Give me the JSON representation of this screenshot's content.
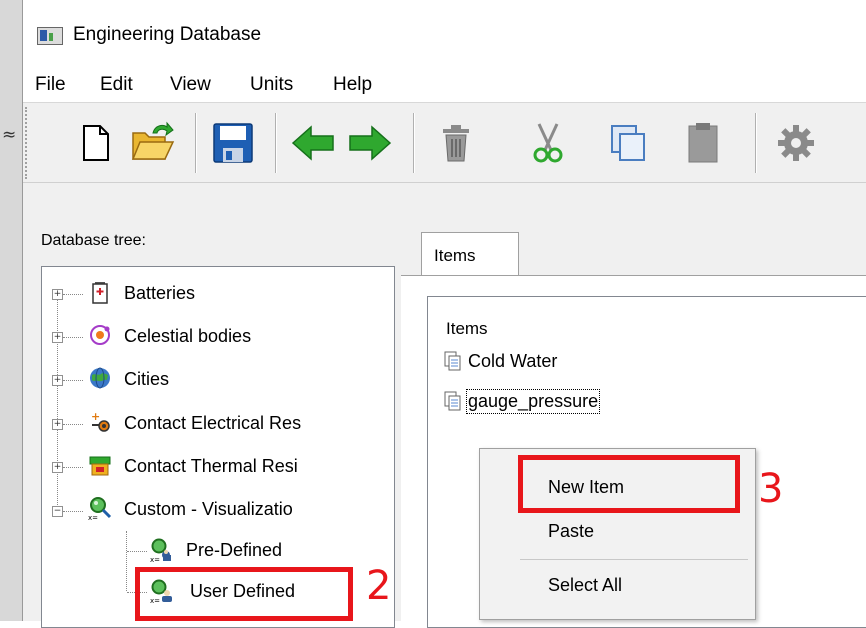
{
  "window": {
    "title": "Engineering Database"
  },
  "side_glyph": "≈",
  "menu": [
    {
      "label": "File"
    },
    {
      "label": "Edit"
    },
    {
      "label": "View"
    },
    {
      "label": "Units"
    },
    {
      "label": "Help"
    }
  ],
  "toolbar_icons": [
    "new-file-icon",
    "open-folder-icon",
    "save-icon",
    "back-arrow-icon",
    "forward-arrow-icon",
    "delete-icon",
    "cut-icon",
    "copy-icon",
    "paste-icon",
    "settings-gear-icon"
  ],
  "left_panel": {
    "label": "Database tree:",
    "tree": [
      {
        "label": "Batteries",
        "icon": "battery-icon"
      },
      {
        "label": "Celestial bodies",
        "icon": "celestial-icon"
      },
      {
        "label": "Cities",
        "icon": "globe-icon"
      },
      {
        "label": "Contact Electrical Res",
        "icon": "electrical-contact-icon"
      },
      {
        "label": "Contact Thermal Resi",
        "icon": "thermal-contact-icon"
      },
      {
        "label": "Custom - Visualizatio",
        "icon": "visualization-icon"
      },
      {
        "label": "Pre-Defined",
        "icon": "predefined-icon"
      },
      {
        "label": "User Defined",
        "icon": "user-defined-icon"
      }
    ]
  },
  "right_panel": {
    "tab_label": "Items",
    "list_header": "Items",
    "items": [
      {
        "label": "Cold Water"
      },
      {
        "label": "gauge_pressure"
      }
    ]
  },
  "context_menu": {
    "items": [
      {
        "label": "New Item"
      },
      {
        "label": "Paste"
      },
      {
        "label": "Select All"
      }
    ]
  },
  "callouts": {
    "user_defined_num": "2",
    "new_item_num": "3"
  },
  "colors": {
    "callout_red": "#e8161b",
    "arrow_green": "#2fa82f",
    "save_blue": "#1e5fb4"
  }
}
